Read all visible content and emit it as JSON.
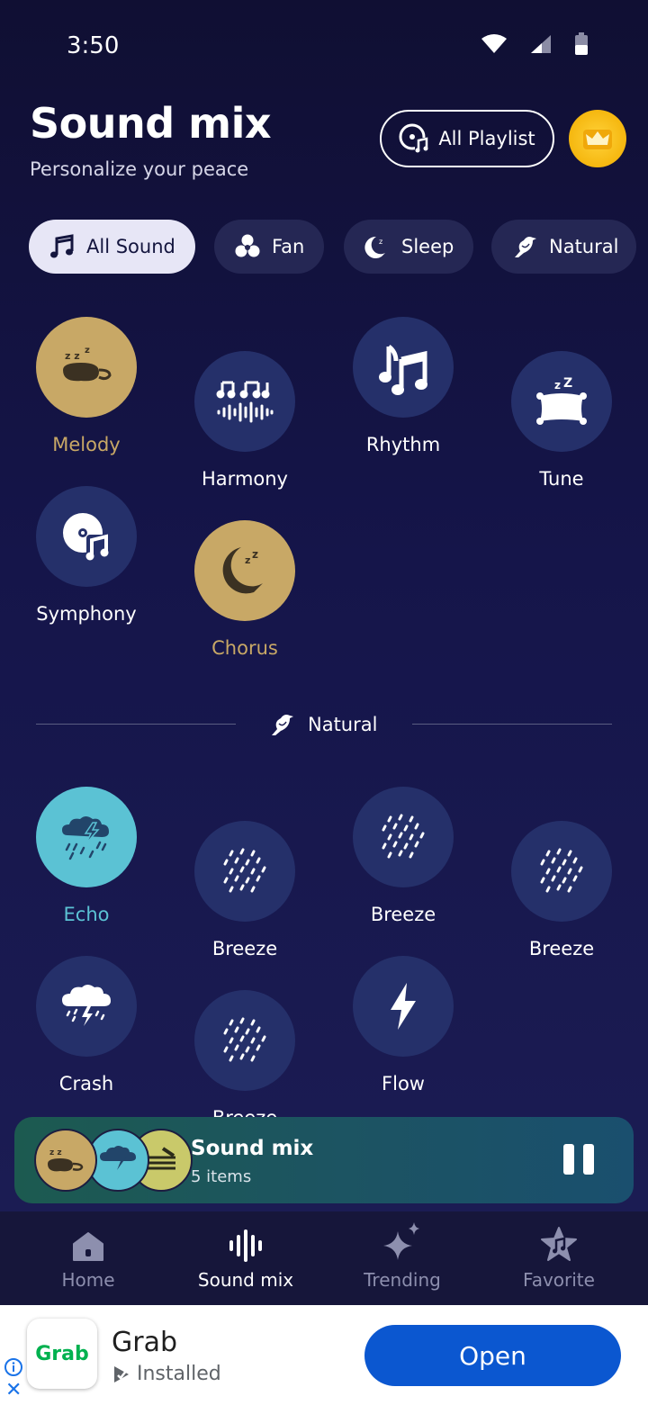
{
  "status_bar": {
    "time": "3:50"
  },
  "header": {
    "title": "Sound mix",
    "subtitle": "Personalize your peace",
    "playlist_label": "All Playlist"
  },
  "chips": [
    {
      "label": "All Sound",
      "icon": "music-notes-icon",
      "active": true
    },
    {
      "label": "Fan",
      "icon": "fan-icon",
      "active": false
    },
    {
      "label": "Sleep",
      "icon": "moon-icon",
      "active": false
    },
    {
      "label": "Natural",
      "icon": "bird-icon",
      "active": false
    }
  ],
  "sounds": [
    {
      "label": "Melody",
      "icon": "sleep-mask-icon",
      "selected": true
    },
    {
      "label": "Harmony",
      "icon": "music-waveform-icon",
      "selected": false
    },
    {
      "label": "Rhythm",
      "icon": "music-notes-icon",
      "selected": false
    },
    {
      "label": "Tune",
      "icon": "pillow-icon",
      "selected": false
    },
    {
      "label": "Symphony",
      "icon": "music-disc-icon",
      "selected": false
    },
    {
      "label": "Chorus",
      "icon": "sleeping-moon-icon",
      "selected": true
    }
  ],
  "natural_section": {
    "label": "Natural",
    "sounds": [
      {
        "label": "Echo",
        "icon": "thunderstorm-icon",
        "selected": true
      },
      {
        "label": "Breeze",
        "icon": "rain-icon",
        "selected": false
      },
      {
        "label": "Breeze",
        "icon": "rain-icon",
        "selected": false
      },
      {
        "label": "Breeze",
        "icon": "rain-icon",
        "selected": false
      },
      {
        "label": "Crash",
        "icon": "storm-cloud-icon",
        "selected": false
      },
      {
        "label": "Breeze",
        "icon": "rain-icon",
        "selected": false
      },
      {
        "label": "Flow",
        "icon": "lightning-icon",
        "selected": false
      }
    ]
  },
  "player": {
    "title": "Sound mix",
    "subtitle": "5 items"
  },
  "bottom_nav": [
    {
      "label": "Home",
      "icon": "home-icon",
      "active": false
    },
    {
      "label": "Sound mix",
      "icon": "waveform-icon",
      "active": true
    },
    {
      "label": "Trending",
      "icon": "sparkle-icon",
      "active": false
    },
    {
      "label": "Favorite",
      "icon": "favorite-star-icon",
      "active": false
    }
  ],
  "ad": {
    "logo_text": "Grab",
    "name": "Grab",
    "status": "Installed",
    "cta": "Open"
  },
  "colors": {
    "background": "#15154a",
    "circle": "#25306a",
    "gold": "#c8a866",
    "cyan": "#5bc2d4",
    "ad_button": "#0b57d0"
  }
}
